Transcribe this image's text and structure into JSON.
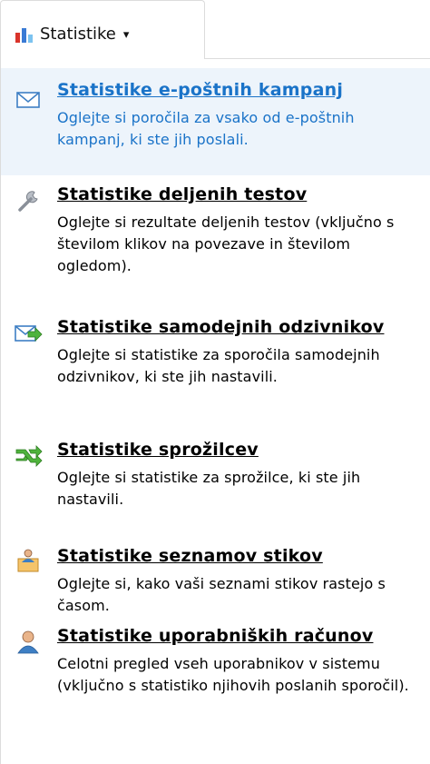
{
  "tab": {
    "label": "Statistike",
    "icon": "bar-chart-icon",
    "caret": "▾"
  },
  "items": [
    {
      "title": "Statistike e-poštnih kampanj",
      "desc": "Oglejte si poročila za vsako od e-poštnih kampanj, ki ste jih poslali.",
      "icon": "envelope-icon"
    },
    {
      "title": "Statistike deljenih testov",
      "desc": "Oglejte si rezultate deljenih testov (vključno s številom klikov na povezave in številom ogledom).",
      "icon": "wrench-icon"
    },
    {
      "title": "Statistike samodejnih odzivnikov",
      "desc": "Oglejte si statistike za sporočila samodejnih odzivnikov, ki ste jih nastavili.",
      "icon": "autoresponder-icon"
    },
    {
      "title": "Statistike sprožilcev",
      "desc": "Oglejte si statistike za sprožilce, ki ste jih nastavili.",
      "icon": "trigger-arrows-icon"
    },
    {
      "title": "Statistike seznamov stikov",
      "desc": "Oglejte si, kako vaši seznami stikov rastejo s časom.",
      "icon": "contact-list-icon"
    },
    {
      "title": "Statistike uporabniških računov",
      "desc": "Celotni pregled vseh uporabnikov v sistemu (vključno s statistiko njihovih poslanih sporočil).",
      "icon": "user-icon"
    }
  ],
  "colors": {
    "accent": "#1a73c8",
    "highlight_bg": "#edf4fb",
    "border": "#dcdcdc"
  }
}
